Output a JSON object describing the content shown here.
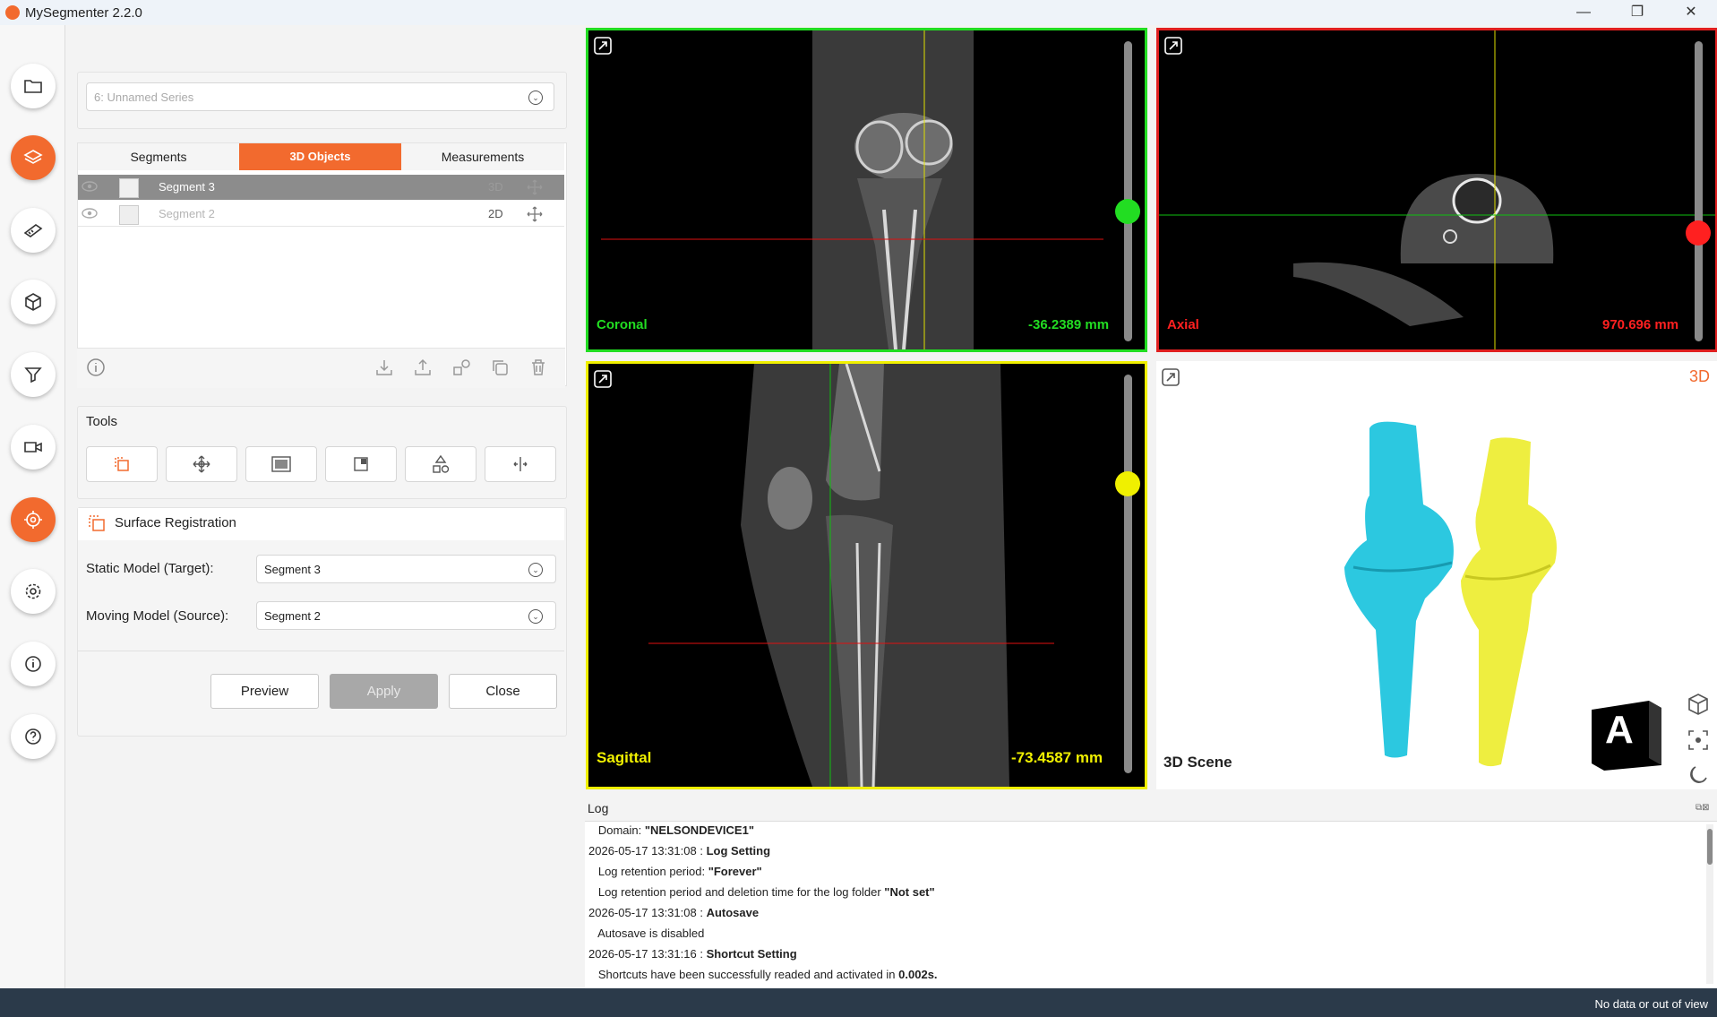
{
  "app": {
    "title": "MySegmenter 2.2.0",
    "logo_text": "My"
  },
  "window_controls": {
    "minimize": "—",
    "maximize": "❐",
    "close": "✕"
  },
  "rail": [
    {
      "name": "folder-icon",
      "active": false
    },
    {
      "name": "layers-icon",
      "active": true
    },
    {
      "name": "ruler-icon",
      "active": false
    },
    {
      "name": "cube-icon",
      "active": false
    },
    {
      "name": "filter-icon",
      "active": false
    },
    {
      "name": "video-camera-icon",
      "active": false
    },
    {
      "name": "target-icon",
      "active": true
    },
    {
      "name": "gear-icon",
      "active": false
    },
    {
      "name": "info-icon",
      "active": false
    },
    {
      "name": "help-icon",
      "active": false
    }
  ],
  "series": {
    "value": "6: Unnamed Series"
  },
  "tabs": [
    {
      "label": "Segments",
      "active": false
    },
    {
      "label": "3D Objects",
      "active": true
    },
    {
      "label": "Measurements",
      "active": false
    }
  ],
  "objects": [
    {
      "name": "Segment 3",
      "mode": "3D",
      "selected": true
    },
    {
      "name": "Segment 2",
      "mode": "2D",
      "selected": false
    }
  ],
  "tools": {
    "label": "Tools"
  },
  "registration": {
    "title": "Surface Registration",
    "static_label": "Static Model (Target):",
    "static_value": "Segment 3",
    "moving_label": "Moving Model (Source):",
    "moving_value": "Segment 2",
    "preview_label": "Preview",
    "apply_label": "Apply",
    "close_label": "Close"
  },
  "viewports": {
    "coronal": {
      "label": "Coronal",
      "value": "-36.2389 mm",
      "color": "#22dd22",
      "slider": 0.48
    },
    "axial": {
      "label": "Axial",
      "value": "970.696 mm",
      "color": "#ff2020",
      "slider": 0.67
    },
    "sagittal": {
      "label": "Sagittal",
      "value": "-73.4587 mm",
      "color": "#f0f000",
      "slider": 0.27
    },
    "scene": {
      "label": "3D Scene",
      "tag": "3D",
      "orient_letter": "A"
    }
  },
  "log": {
    "title": "Log",
    "lines": [
      {
        "prefix": "   Domain: ",
        "bold": "\"NELSONDEVICE1\"",
        "suffix": ""
      },
      {
        "prefix": "2026-05-17 13:31:08 : ",
        "bold": "Log Setting",
        "suffix": ""
      },
      {
        "prefix": "   Log retention period: ",
        "bold": "\"Forever\"",
        "suffix": ""
      },
      {
        "prefix": "   Log retention period and deletion time for the log folder ",
        "bold": "\"Not set\"",
        "suffix": ""
      },
      {
        "prefix": "2026-05-17 13:31:08 : ",
        "bold": "Autosave",
        "suffix": ""
      },
      {
        "prefix": "   Autosave is disabled",
        "bold": "",
        "suffix": ""
      },
      {
        "prefix": "2026-05-17 13:31:16 : ",
        "bold": "Shortcut Setting",
        "suffix": ""
      },
      {
        "prefix": "   Shortcuts have been successfully readed and activated in ",
        "bold": "0.002s.",
        "suffix": ""
      }
    ]
  },
  "status": {
    "text": "No data or out of view"
  }
}
